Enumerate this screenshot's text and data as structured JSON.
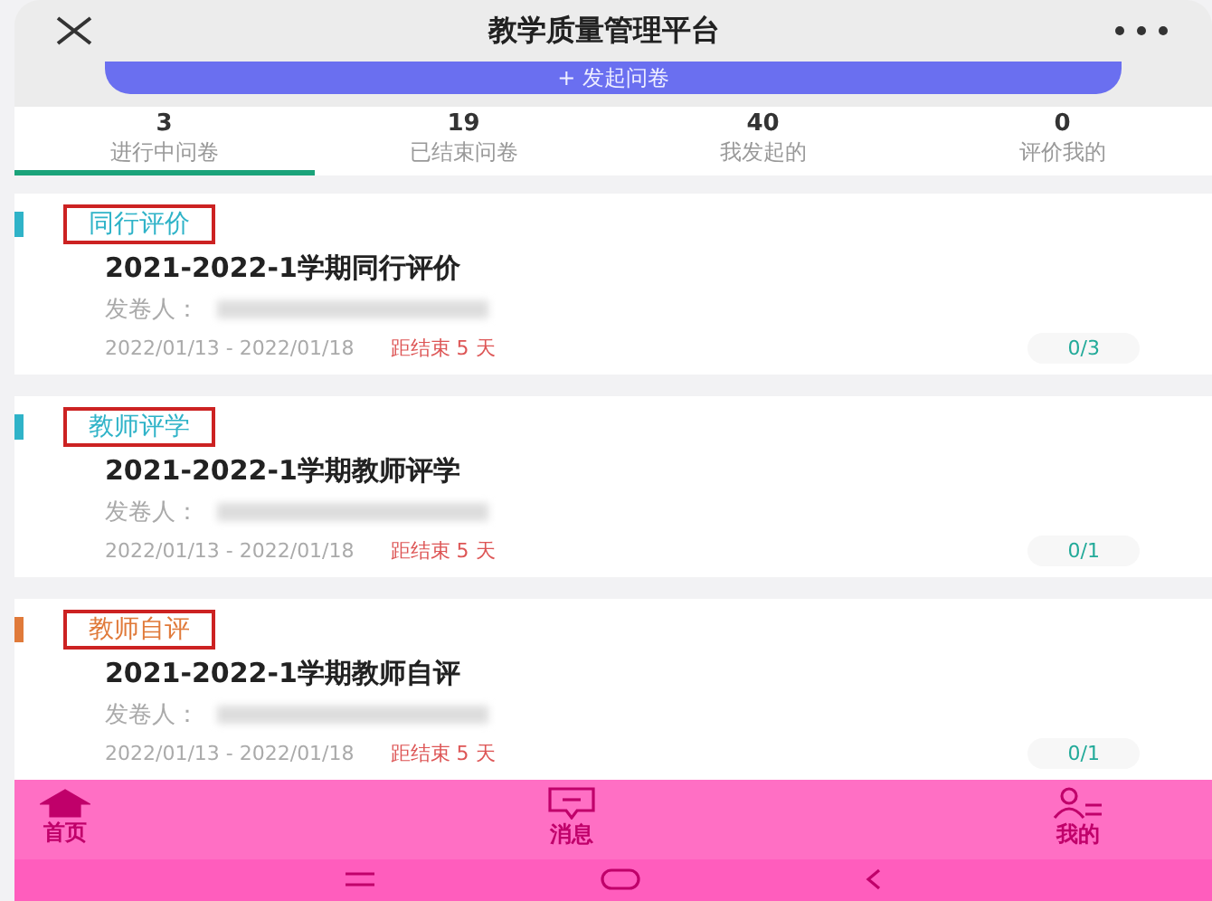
{
  "header": {
    "title": "教学质量管理平台"
  },
  "action_button": {
    "label": "+ 发起问卷"
  },
  "tabs": [
    {
      "count": "3",
      "label": "进行中问卷",
      "selected": true
    },
    {
      "count": "19",
      "label": "已结束问卷",
      "selected": false
    },
    {
      "count": "40",
      "label": "我发起的",
      "selected": false
    },
    {
      "count": "0",
      "label": "评价我的",
      "selected": false
    }
  ],
  "cards": [
    {
      "tag": "同行评价",
      "color": "#2fb3c8",
      "title": "2021-2022-1学期同行评价",
      "sender_label": "发卷人：",
      "dates": "2022/01/13 - 2022/01/18",
      "remaining": "距结束 5 天",
      "progress": "0/3"
    },
    {
      "tag": "教师评学",
      "color": "#2fb3c8",
      "title": "2021-2022-1学期教师评学",
      "sender_label": "发卷人：",
      "dates": "2022/01/13 - 2022/01/18",
      "remaining": "距结束 5 天",
      "progress": "0/1"
    },
    {
      "tag": "教师自评",
      "color": "#e07a3a",
      "title": "2021-2022-1学期教师自评",
      "sender_label": "发卷人：",
      "dates": "2022/01/13 - 2022/01/18",
      "remaining": "距结束 5 天",
      "progress": "0/1"
    }
  ],
  "bottom_nav": [
    {
      "kind": "home",
      "label": "首页",
      "selected": true
    },
    {
      "kind": "message",
      "label": "消息",
      "selected": false
    },
    {
      "kind": "profile",
      "label": "我的",
      "selected": false
    }
  ]
}
